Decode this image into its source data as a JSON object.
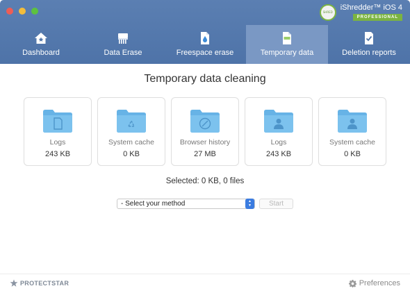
{
  "window": {
    "colors": {
      "header": "#5b7fb2",
      "active_tab": "#7a98c4",
      "folder": "#7cc2ee",
      "select_accent": "#3b7ce0",
      "brand_green": "#7bb441"
    }
  },
  "brand": {
    "title": "iShredder™ iOS 4",
    "badge": "PROFESSIONAL",
    "seal_text": "SHRED"
  },
  "tabs": [
    {
      "label": "Dashboard",
      "icon": "home-icon",
      "active": false
    },
    {
      "label": "Data Erase",
      "icon": "shredder-icon",
      "active": false
    },
    {
      "label": "Freespace erase",
      "icon": "document-drop-icon",
      "active": false
    },
    {
      "label": "Temporary data",
      "icon": "tmp-file-icon",
      "active": true
    },
    {
      "label": "Deletion reports",
      "icon": "checklist-report-icon",
      "active": false
    }
  ],
  "main": {
    "title": "Temporary data cleaning",
    "cards": [
      {
        "name": "Logs",
        "size": "243 KB",
        "icon": "document-folder-icon"
      },
      {
        "name": "System cache",
        "size": "0 KB",
        "icon": "recycle-folder-icon"
      },
      {
        "name": "Browser history",
        "size": "27 MB",
        "icon": "compass-folder-icon"
      },
      {
        "name": "Logs",
        "size": "243 KB",
        "icon": "user-folder-icon"
      },
      {
        "name": "System cache",
        "size": "0 KB",
        "icon": "user-folder-icon"
      }
    ],
    "selected_summary": "Selected: 0 KB, 0 files",
    "method_select": {
      "value": "- Select your method"
    },
    "start_label": "Start"
  },
  "footer": {
    "logo_text": "PROTECTSTAR",
    "preferences_label": "Preferences"
  }
}
